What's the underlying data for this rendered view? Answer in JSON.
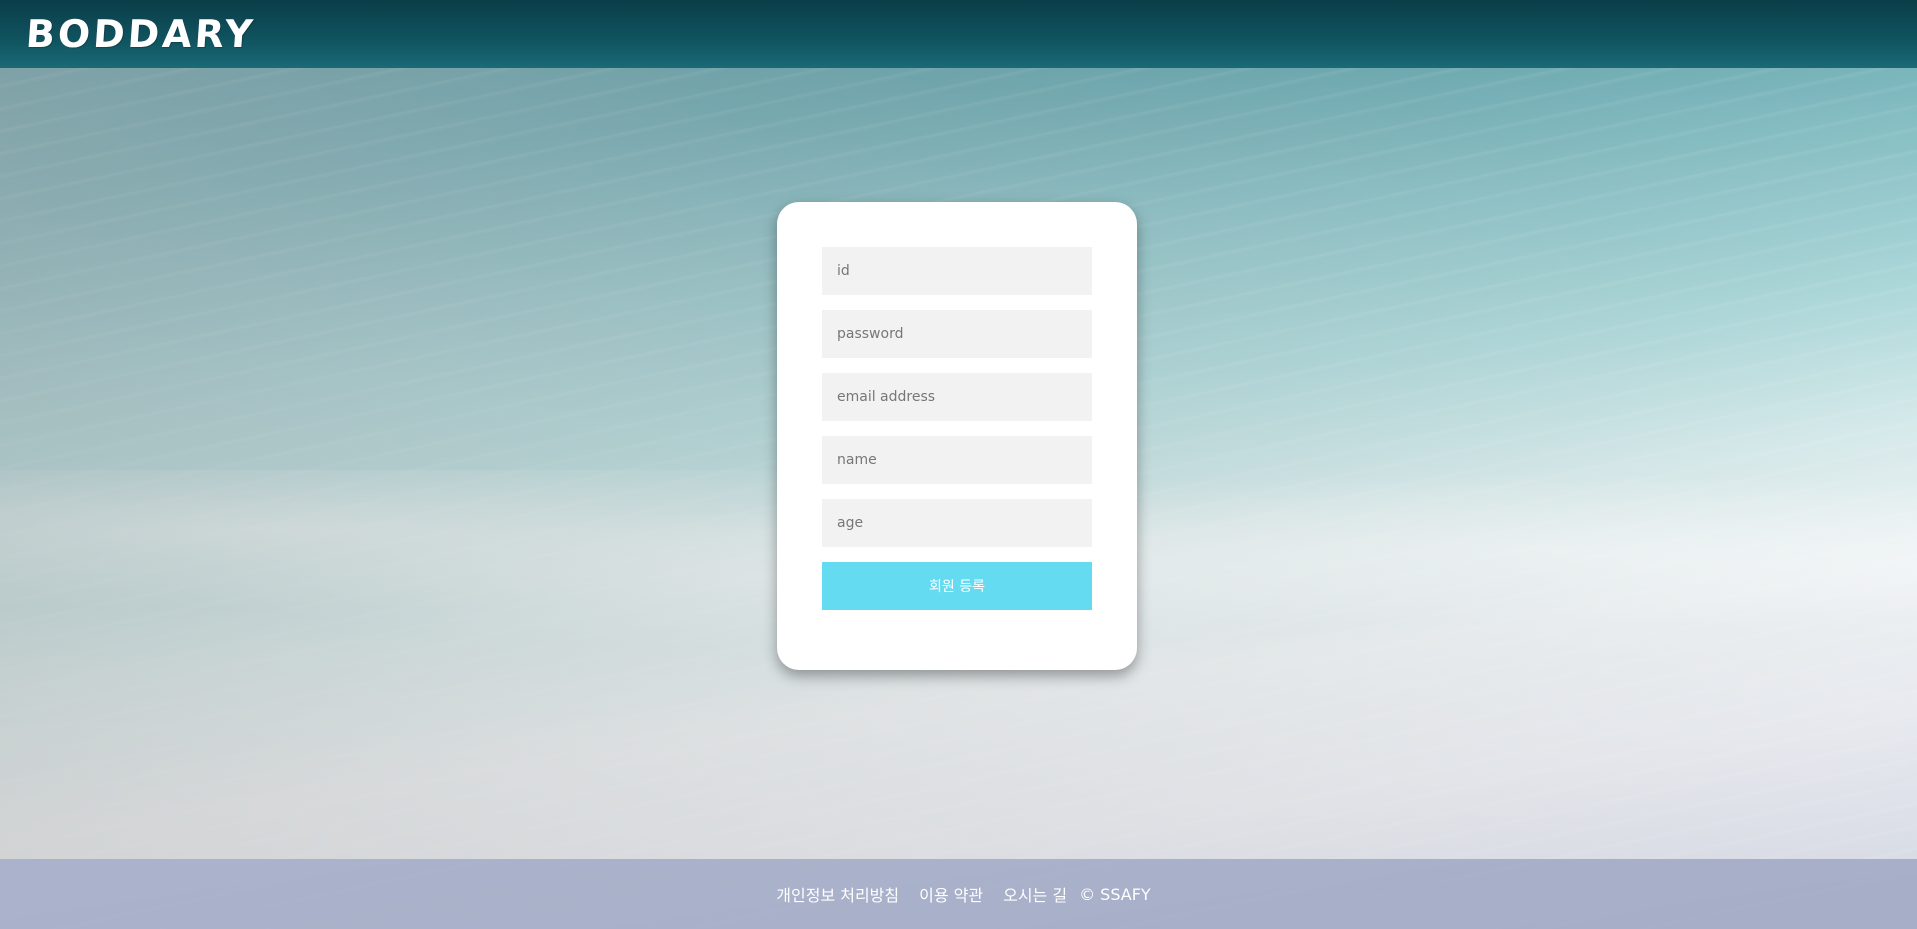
{
  "brand": {
    "logo_text": "BODDARY"
  },
  "signup_form": {
    "id_placeholder": "id",
    "password_placeholder": "password",
    "email_placeholder": "email address",
    "name_placeholder": "name",
    "age_placeholder": "age",
    "submit_label": "회원 등록"
  },
  "footer": {
    "links": [
      {
        "label": "개인정보 처리방침"
      },
      {
        "label": "이용 약관"
      },
      {
        "label": "오시는 길"
      }
    ],
    "copyright": "© SSAFY"
  },
  "colors": {
    "header_bg": "#0f5460",
    "submit_bg": "#64dbf1",
    "input_bg": "#f2f2f2",
    "card_bg": "#ffffff"
  }
}
